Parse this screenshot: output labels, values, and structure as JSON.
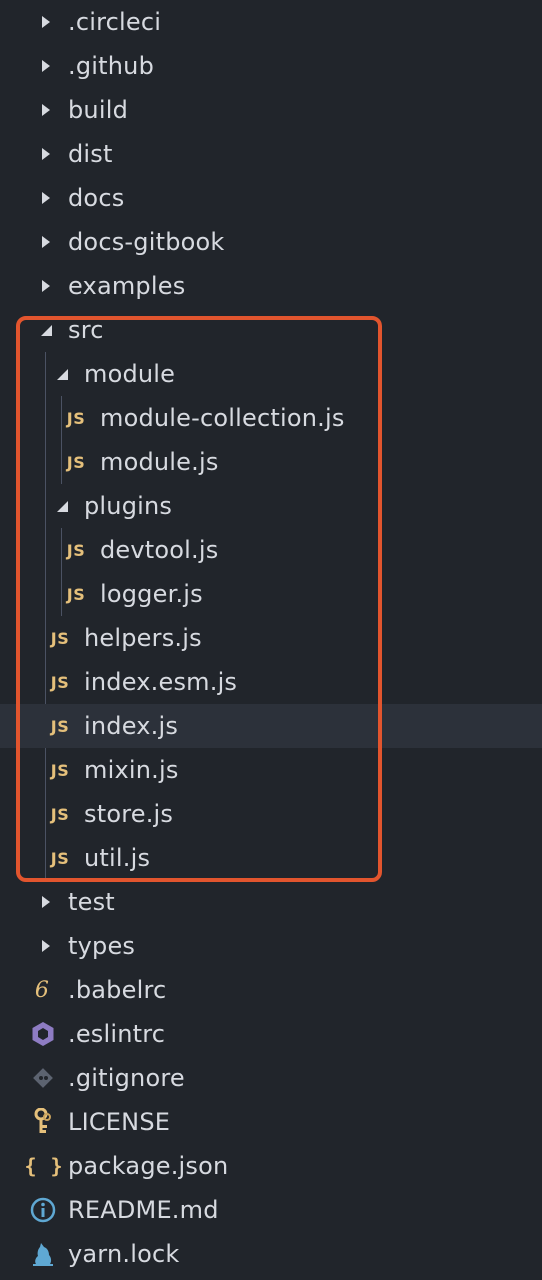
{
  "tree": {
    "circleci": ".circleci",
    "github": ".github",
    "build": "build",
    "dist": "dist",
    "docs": "docs",
    "docs_gitbook": "docs-gitbook",
    "examples": "examples",
    "src": "src",
    "module": "module",
    "module_collection": "module-collection.js",
    "module_js": "module.js",
    "plugins": "plugins",
    "devtool": "devtool.js",
    "logger": "logger.js",
    "helpers": "helpers.js",
    "index_esm": "index.esm.js",
    "index_js": "index.js",
    "mixin": "mixin.js",
    "store": "store.js",
    "util": "util.js",
    "test": "test",
    "types": "types",
    "babelrc": ".babelrc",
    "eslintrc": ".eslintrc",
    "gitignore": ".gitignore",
    "license": "LICENSE",
    "package_json": "package.json",
    "readme": "README.md",
    "yarn_lock": "yarn.lock"
  },
  "icons": {
    "js_label": "JS",
    "babel_glyph": "6",
    "json_glyph": "{ }"
  },
  "colors": {
    "background": "#21252b",
    "selected_row": "#2c313a",
    "text": "#d7dae0",
    "js_icon": "#e5c07b",
    "highlight_border": "#e2552e",
    "eslint_icon": "#8e7cc3",
    "info_icon": "#5fa8d3",
    "git_icon": "#5c6370"
  },
  "selected_item": "index.js"
}
